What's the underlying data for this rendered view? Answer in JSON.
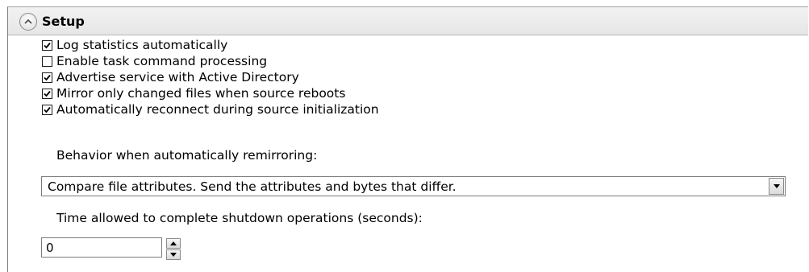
{
  "section": {
    "title": "Setup",
    "collapse_icon": "chevron-up-icon"
  },
  "checkboxes": [
    {
      "label": "Log statistics automatically",
      "checked": true
    },
    {
      "label": "Enable task command processing",
      "checked": false
    },
    {
      "label": "Advertise service with Active Directory",
      "checked": true
    },
    {
      "label": "Mirror only changed files when source reboots",
      "checked": true
    },
    {
      "label": "Automatically reconnect during source initialization",
      "checked": true
    }
  ],
  "remirror": {
    "label": "Behavior when automatically remirroring:",
    "selected": "Compare file attributes. Send the attributes and bytes that differ."
  },
  "shutdown": {
    "label": "Time allowed to complete shutdown operations (seconds):",
    "value": "0"
  }
}
